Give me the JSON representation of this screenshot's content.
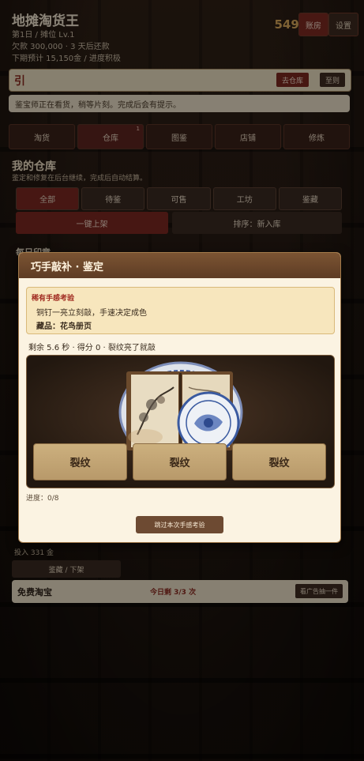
{
  "header": {
    "title": "地摊淘货王",
    "line1": "第1日 / 摊位 Lv.1",
    "line2": "欠款 300,000 · 3 天后还款",
    "line3": "下期预计 15,150金 / 进度积极",
    "gold": "549 金",
    "ledger_label": "账房",
    "settings_label": "设置"
  },
  "guide": {
    "char": "引",
    "goto_warehouse": "去仓库",
    "close": "至则"
  },
  "notice": "鉴宝师正在看货，稍等片刻。完成后会有提示。",
  "nav": {
    "tabs": [
      {
        "label": "淘货"
      },
      {
        "label": "仓库",
        "badge": "1"
      },
      {
        "label": "图鉴"
      },
      {
        "label": "店铺"
      },
      {
        "label": "修炼"
      }
    ]
  },
  "warehouse": {
    "title": "我的仓库",
    "subtitle": "鉴定和修复在后台继续，完成后自动结算。",
    "filters": [
      "全部",
      "待鉴",
      "可售",
      "工坊",
      "鉴藏"
    ],
    "list_all": "一键上架",
    "sort": "排序：新入库",
    "daily": "每日印章"
  },
  "bottom": {
    "invest": "投入 331 金",
    "tab": "鉴藏 / 下架",
    "free_title": "免费淘宝",
    "free_remaining": "今日剩 3/3 次",
    "ad_button": "看广告抽一件"
  },
  "modal": {
    "title": "巧手敲补 · 鉴定",
    "rare_title": "稀有手感考验",
    "rare_desc": "铜钉一亮立刻敲，手速决定成色",
    "collection": "藏品：花鸟册页",
    "status": "剩余 5.6 秒 · 得分 0 · 裂纹亮了就敲",
    "tiles": [
      "裂纹",
      "裂纹",
      "裂纹"
    ],
    "progress": "进度：0/8",
    "skip": "跳过本次手感考验"
  }
}
